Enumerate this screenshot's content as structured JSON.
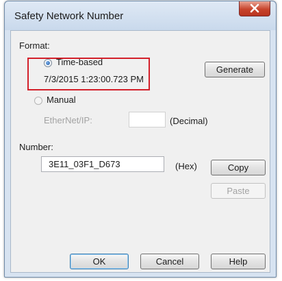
{
  "window": {
    "title": "Safety Network Number"
  },
  "format": {
    "label": "Format:",
    "time_based_label": "Time-based",
    "time_based_value": "7/3/2015 1:23:00.723 PM",
    "generate_label": "Generate",
    "manual_label": "Manual",
    "ethernet_label": "EtherNet/IP:",
    "ethernet_value": "",
    "decimal_label": "(Decimal)"
  },
  "number": {
    "label": "Number:",
    "value": "3E11_03F1_D673",
    "hex_label": "(Hex)",
    "copy_label": "Copy",
    "paste_label": "Paste"
  },
  "footer": {
    "ok_label": "OK",
    "cancel_label": "Cancel",
    "help_label": "Help"
  },
  "colors": {
    "highlight": "#d3202a",
    "close_button": "#c8442c"
  },
  "icons": {
    "close": "close-icon"
  }
}
